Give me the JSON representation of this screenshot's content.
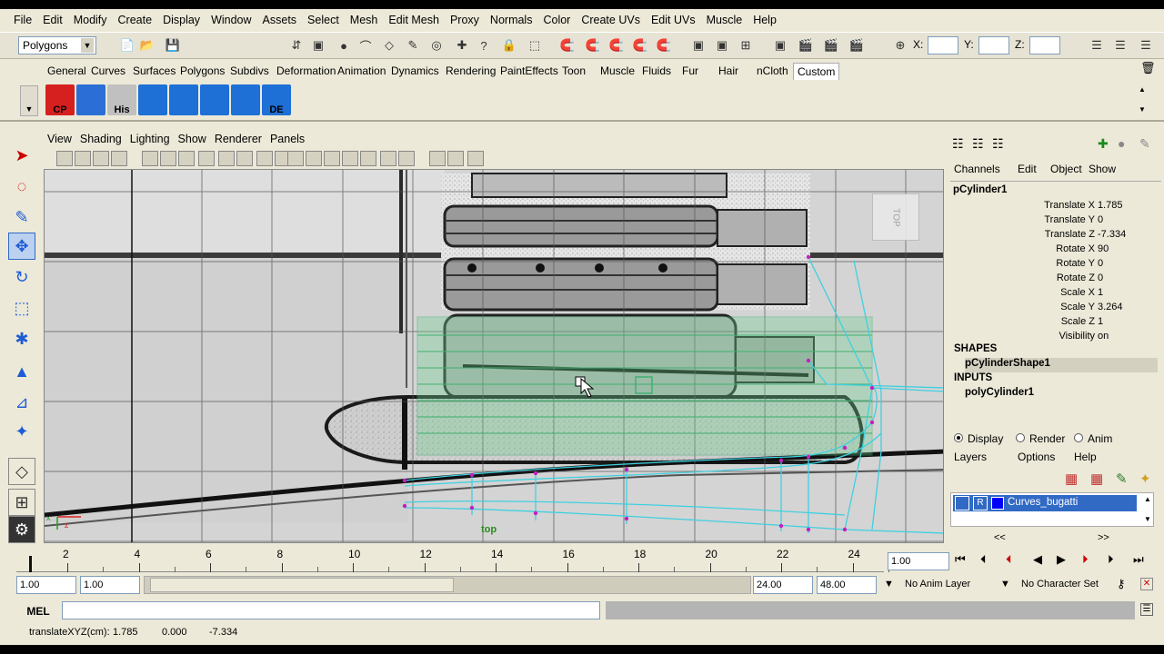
{
  "menubar": [
    "File",
    "Edit",
    "Modify",
    "Create",
    "Display",
    "Window",
    "Assets",
    "Select",
    "Mesh",
    "Edit Mesh",
    "Proxy",
    "Normals",
    "Color",
    "Create UVs",
    "Edit UVs",
    "Muscle",
    "Help"
  ],
  "status_line": {
    "menuset": "Polygons",
    "x_label": "X:",
    "y_label": "Y:",
    "z_label": "Z:",
    "x_value": "",
    "y_value": "",
    "z_value": ""
  },
  "shelf_tabs": [
    "General",
    "Curves",
    "Surfaces",
    "Polygons",
    "Subdivs",
    "Deformation",
    "Animation",
    "Dynamics",
    "Rendering",
    "PaintEffects",
    "Toon",
    "Muscle",
    "Fluids",
    "Fur",
    "Hair",
    "nCloth",
    "Custom"
  ],
  "shelf_active_tab": "Custom",
  "shelf_icons": [
    {
      "label": "CP",
      "icon": "cp-icon",
      "color": "#d62020"
    },
    {
      "label": "",
      "icon": "grid-icon",
      "color": "#2b6fd6"
    },
    {
      "label": "His",
      "icon": "history-icon",
      "color": "#c0c0c0"
    },
    {
      "label": "",
      "icon": "cube-icon",
      "color": "#1e6fd6"
    },
    {
      "label": "",
      "icon": "uv-icon",
      "color": "#1e6fd6"
    },
    {
      "label": "",
      "icon": "uv-red-icon",
      "color": "#1e6fd6"
    },
    {
      "label": "",
      "icon": "uv-split-icon",
      "color": "#1e6fd6"
    },
    {
      "label": "DE",
      "icon": "de-icon",
      "color": "#1e6fd6"
    }
  ],
  "panel_menu": [
    "View",
    "Shading",
    "Lighting",
    "Show",
    "Renderer",
    "Panels"
  ],
  "viewport": {
    "camera_label": "top",
    "viewcube_label": "TOP"
  },
  "channel_box": {
    "menu": [
      "Channels",
      "Edit",
      "Object",
      "Show"
    ],
    "object_name": "pCylinder1",
    "attributes": [
      {
        "name": "Translate X",
        "value": "1.785"
      },
      {
        "name": "Translate Y",
        "value": "0"
      },
      {
        "name": "Translate Z",
        "value": "-7.334"
      },
      {
        "name": "Rotate X",
        "value": "90"
      },
      {
        "name": "Rotate Y",
        "value": "0"
      },
      {
        "name": "Rotate Z",
        "value": "0"
      },
      {
        "name": "Scale X",
        "value": "1"
      },
      {
        "name": "Scale Y",
        "value": "3.264"
      },
      {
        "name": "Scale Z",
        "value": "1"
      },
      {
        "name": "Visibility",
        "value": "on"
      }
    ],
    "shapes_header": "SHAPES",
    "shape_name": "pCylinderShape1",
    "inputs_header": "INPUTS",
    "input_name": "polyCylinder1",
    "layer_modes": [
      "Display",
      "Render",
      "Anim"
    ],
    "layer_menu": [
      "Layers",
      "Options",
      "Help"
    ],
    "layer": {
      "r_flag": "R",
      "name": "Curves_bugatti"
    },
    "scroll_left": "<<",
    "scroll_right": ">>"
  },
  "timeline": {
    "ticks": [
      "2",
      "4",
      "6",
      "8",
      "10",
      "12",
      "14",
      "16",
      "18",
      "20",
      "22",
      "24"
    ],
    "current_frame": "1.00"
  },
  "range": {
    "start": "1.00",
    "playback_start": "1.00",
    "playback_end": "24.00",
    "end": "48.00",
    "anim_layer": "No Anim Layer",
    "character_set": "No Character Set"
  },
  "command_line": {
    "label": "MEL",
    "value": ""
  },
  "help_line": {
    "label": "translateXYZ(cm):",
    "x": "1.785",
    "y": "0.000",
    "z": "-7.334"
  },
  "colors": {
    "ui_bg": "#ece9d8",
    "selection_blue": "#316ac5",
    "wire_cyan": "#3fd0e0",
    "selection_green": "#5fd080"
  }
}
